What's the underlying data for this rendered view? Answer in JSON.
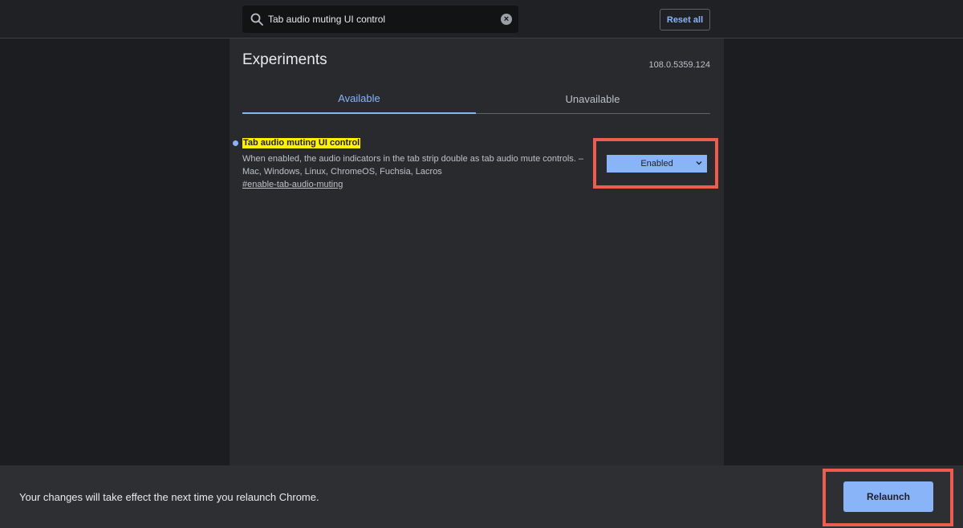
{
  "search": {
    "value": "Tab audio muting UI control",
    "icon": "search-icon",
    "clear_icon": "clear-icon"
  },
  "header": {
    "reset_label": "Reset all"
  },
  "page": {
    "title": "Experiments",
    "version": "108.0.5359.124"
  },
  "tabs": [
    {
      "label": "Available",
      "active": true
    },
    {
      "label": "Unavailable",
      "active": false
    }
  ],
  "experiment": {
    "name": "Tab audio muting UI control",
    "description_line1": "When enabled, the audio indicators in the tab strip double as tab audio mute controls. –",
    "description_line2": "Mac, Windows, Linux, ChromeOS, Fuchsia, Lacros",
    "link": "#enable-tab-audio-muting",
    "selected_option": "Enabled"
  },
  "footer": {
    "message": "Your changes will take effect the next time you relaunch Chrome.",
    "relaunch_label": "Relaunch"
  },
  "colors": {
    "accent": "#8ab4f8",
    "highlight": "#fff200",
    "annotation": "#ee5b4f"
  }
}
